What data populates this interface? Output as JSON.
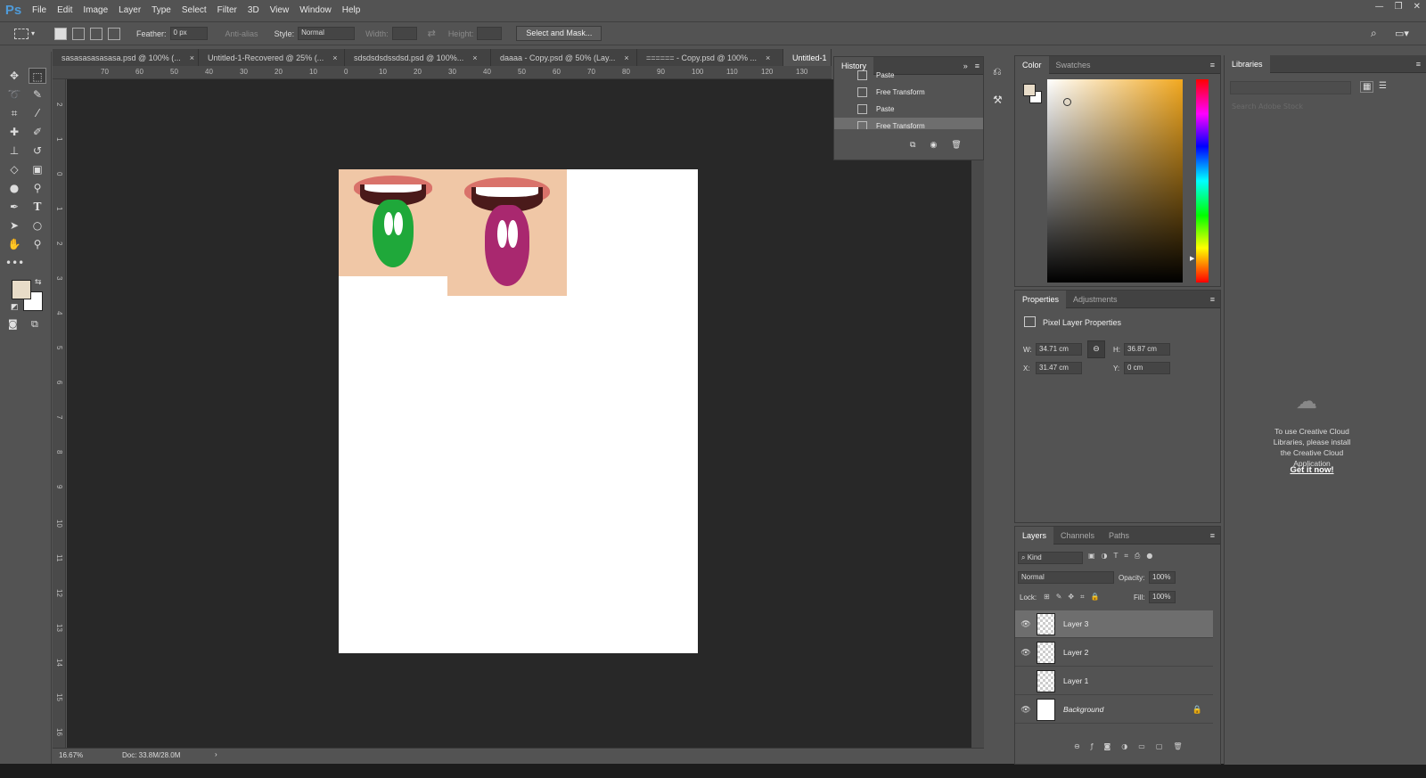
{
  "app": {
    "logo": "Ps"
  },
  "menu": [
    "File",
    "Edit",
    "Image",
    "Layer",
    "Type",
    "Select",
    "Filter",
    "3D",
    "View",
    "Window",
    "Help"
  ],
  "options": {
    "feather_label": "Feather:",
    "feather_value": "0 px",
    "antialias_label": "Anti-alias",
    "style_label": "Style:",
    "style_value": "Normal",
    "width_label": "Width:",
    "height_label": "Height:",
    "select_mask_label": "Select and Mask..."
  },
  "tabs": [
    {
      "label": "sasasasasasasa.psd @ 100% (...",
      "close": "×"
    },
    {
      "label": "Untitled-1-Recovered @ 25% (...",
      "close": "×"
    },
    {
      "label": "sdsdsdsdssdsd.psd @ 100%...",
      "close": "×"
    },
    {
      "label": "daaaa - Copy.psd @ 50% (Lay...",
      "close": "×"
    },
    {
      "label": "====== - Copy.psd @ 100% ...",
      "close": "×"
    },
    {
      "label": "Untitled-1",
      "close": ""
    }
  ],
  "ruler": {
    "h": [
      "70",
      "60",
      "50",
      "40",
      "30",
      "20",
      "10",
      "0",
      "10",
      "20",
      "30",
      "40",
      "50",
      "60",
      "70",
      "80",
      "90",
      "100",
      "110",
      "120",
      "130"
    ],
    "v": [
      "2",
      "1",
      "0",
      "1",
      "2",
      "3",
      "4",
      "5",
      "6",
      "7",
      "8",
      "9",
      "10",
      "11",
      "12",
      "13",
      "14",
      "15",
      "16"
    ]
  },
  "history": {
    "title": "History",
    "items": [
      {
        "label": "Paste",
        "selected": false
      },
      {
        "label": "Free Transform",
        "selected": false
      },
      {
        "label": "Paste",
        "selected": false
      },
      {
        "label": "Free Transform",
        "selected": true
      }
    ]
  },
  "color": {
    "tabs": [
      "Color",
      "Swatches"
    ],
    "foreground": "#e8dcc8",
    "background": "#ffffff"
  },
  "properties": {
    "tabs": [
      "Properties",
      "Adjustments"
    ],
    "subtitle": "Pixel Layer Properties",
    "w_label": "W:",
    "w_value": "34.71 cm",
    "h_label": "H:",
    "h_value": "36.87 cm",
    "x_label": "X:",
    "x_value": "31.47 cm",
    "y_label": "Y:",
    "y_value": "0 cm"
  },
  "layers": {
    "tabs": [
      "Layers",
      "Channels",
      "Paths"
    ],
    "kind_label": "Kind",
    "blend_mode": "Normal",
    "opacity_label": "Opacity:",
    "opacity_value": "100%",
    "lock_label": "Lock:",
    "fill_label": "Fill:",
    "fill_value": "100%",
    "items": [
      {
        "name": "Layer 3",
        "visible": true,
        "selected": true
      },
      {
        "name": "Layer 2",
        "visible": true,
        "selected": false
      },
      {
        "name": "Layer 1",
        "visible": false,
        "selected": false
      },
      {
        "name": "Background",
        "visible": true,
        "selected": false
      }
    ]
  },
  "libraries": {
    "title": "Libraries",
    "search_placeholder": "Search Adobe Stock",
    "message": "To use Creative Cloud Libraries, please install the Creative Cloud Application",
    "cta": "Get it now!"
  },
  "status": {
    "zoom": "16.67%",
    "doc": "Doc: 33.8M/28.0M"
  }
}
